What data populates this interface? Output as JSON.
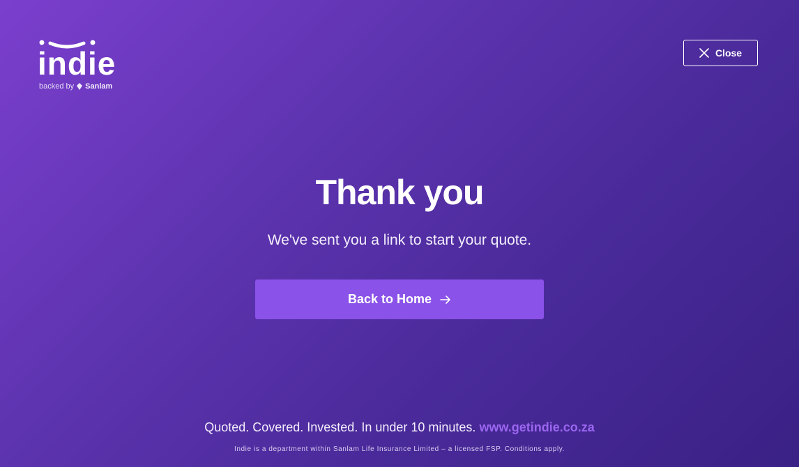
{
  "logo": {
    "wordmark": "indie",
    "backed_by": "backed by",
    "partner": "Sanlam"
  },
  "header": {
    "close_label": "Close"
  },
  "main": {
    "title": "Thank you",
    "subtitle": "We've sent you a link to start your quote.",
    "home_button_label": "Back to Home"
  },
  "footer": {
    "tagline": "Quoted. Covered. Invested. In under 10 minutes.",
    "link_text": "www.getindie.co.za",
    "disclaimer": "Indie is a department within Sanlam Life Insurance Limited – a licensed FSP. Conditions apply."
  },
  "colors": {
    "background_start": "#7b3fce",
    "background_end": "#3a2185",
    "button": "#8a52e8",
    "link": "#9a66f0"
  },
  "icons": {
    "close": "close-icon",
    "arrow": "arrow-right-icon",
    "logo_smile": "smile-icon",
    "partner_mark": "sanlam-mark-icon"
  }
}
